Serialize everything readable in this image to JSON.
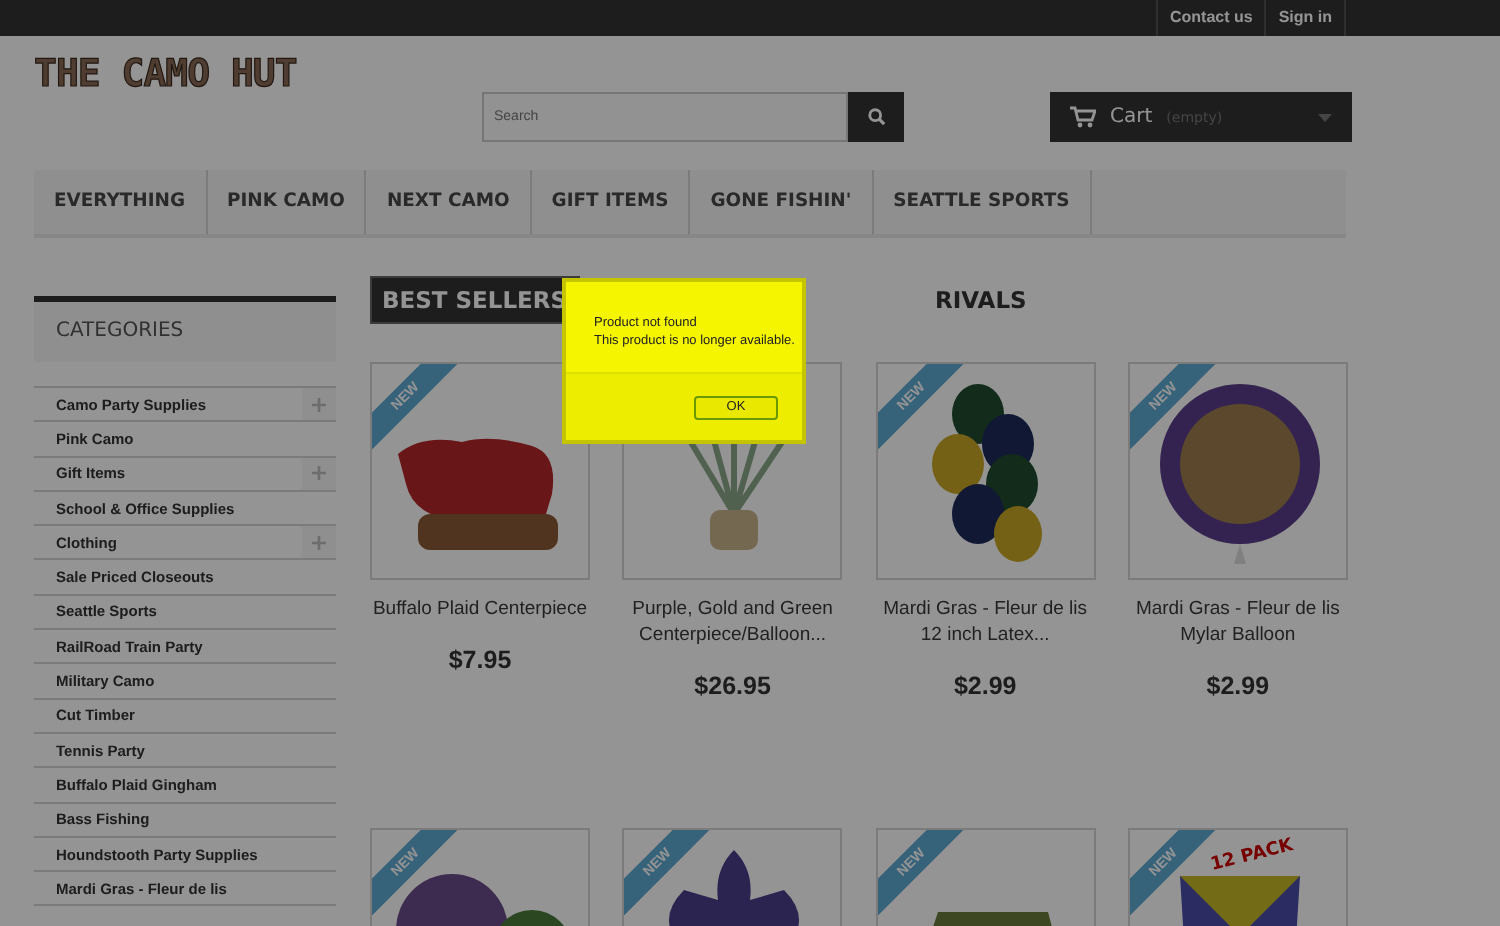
{
  "top_bar": {
    "links": [
      "Contact us",
      "Sign in"
    ]
  },
  "logo": "THE CAMO HUT",
  "search": {
    "placeholder": "Search"
  },
  "cart": {
    "label": "Cart",
    "status": "(empty)"
  },
  "menu": [
    "EVERYTHING",
    "PINK CAMO",
    "NEXT CAMO",
    "GIFT ITEMS",
    "GONE FISHIN'",
    "SEATTLE SPORTS"
  ],
  "sidebar": {
    "title": "CATEGORIES",
    "items": [
      {
        "label": "Camo Party Supplies",
        "expandable": true
      },
      {
        "label": "Pink Camo",
        "expandable": false
      },
      {
        "label": "Gift Items",
        "expandable": true
      },
      {
        "label": "School & Office Supplies",
        "expandable": false
      },
      {
        "label": "Clothing",
        "expandable": true
      },
      {
        "label": "Sale Priced Closeouts",
        "expandable": false
      },
      {
        "label": "Seattle Sports",
        "expandable": false
      },
      {
        "label": "RailRoad Train Party",
        "expandable": false
      },
      {
        "label": "Military Camo",
        "expandable": false
      },
      {
        "label": "Cut Timber",
        "expandable": false
      },
      {
        "label": "Tennis Party",
        "expandable": false
      },
      {
        "label": "Buffalo Plaid Gingham",
        "expandable": false
      },
      {
        "label": "Bass Fishing",
        "expandable": false
      },
      {
        "label": "Houndstooth Party Supplies",
        "expandable": false
      },
      {
        "label": "Mardi Gras - Fleur de lis",
        "expandable": false
      }
    ]
  },
  "tabs": [
    {
      "label": "BEST SELLERS",
      "selected": true
    },
    {
      "label": "RIVALS",
      "selected": false
    }
  ],
  "products": [
    {
      "kind": "bear",
      "badge": "NEW",
      "name": "Buffalo Plaid Centerpiece",
      "price": "$7.95"
    },
    {
      "kind": "centerpiece",
      "name": "Purple, Gold and Green Centerpiece/Balloon...",
      "price": "$26.95"
    },
    {
      "kind": "balloon-bunch",
      "badge": "NEW",
      "name": "Mardi Gras - Fleur de lis 12 inch Latex...",
      "price": "$2.99"
    },
    {
      "kind": "balloon",
      "badge": "NEW",
      "name": "Mardi Gras - Fleur de lis Mylar Balloon",
      "price": "$2.99"
    },
    {
      "kind": "plates",
      "badge": "NEW"
    },
    {
      "kind": "fleur",
      "badge": "NEW"
    },
    {
      "kind": "tablecover",
      "badge": "NEW"
    },
    {
      "kind": "cups",
      "badge": "NEW",
      "label": "12 PACK"
    }
  ],
  "dialog": {
    "title": "Product not found",
    "message": "This product is no longer available.",
    "button": "OK"
  }
}
